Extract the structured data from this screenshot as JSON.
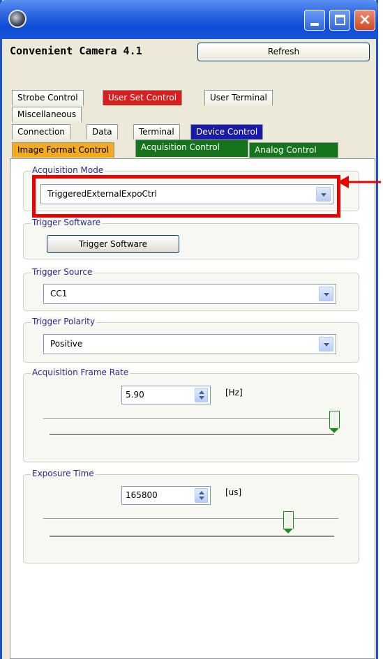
{
  "window": {
    "app_title": "Convenient Camera 4.1",
    "refresh_label": "Refresh"
  },
  "tabs": {
    "row1": [
      {
        "label": "Strobe Control",
        "color": "#ffffff"
      },
      {
        "label": "User Set Control",
        "color": "#d81f1f"
      },
      {
        "label": "User Terminal",
        "color": "#ffffff"
      }
    ],
    "row2": [
      {
        "label": "Miscellaneous",
        "color": "#ffffff"
      }
    ],
    "row3": [
      {
        "label": "Connection",
        "color": "#ffffff"
      },
      {
        "label": "Data",
        "color": "#ffffff"
      },
      {
        "label": "Terminal",
        "color": "#ffffff"
      },
      {
        "label": "Device Control",
        "color": "#1a1aa8"
      }
    ],
    "row4": [
      {
        "label": "Image Format Control",
        "color": "#f5ab1f"
      },
      {
        "label": "Acquisition Control",
        "color": "#16751c",
        "active": true
      },
      {
        "label": "Analog Control",
        "color": "#16751c"
      }
    ]
  },
  "acquisition_mode": {
    "label": "Acquisition Mode",
    "value": "TriggeredExternalExpoCtrl"
  },
  "trigger_software": {
    "label": "Trigger Software",
    "button_label": "Trigger Software"
  },
  "trigger_source": {
    "label": "Trigger Source",
    "value": "CC1"
  },
  "trigger_polarity": {
    "label": "Trigger Polarity",
    "value": "Positive"
  },
  "frame_rate": {
    "label": "Acquisition Frame Rate",
    "value": "5.90",
    "unit": "[Hz]",
    "slider_fraction": 1.0
  },
  "exposure": {
    "label": "Exposure Time",
    "value": "165800",
    "unit": "[us]",
    "slider_fraction": 0.83
  },
  "annotation": {
    "highlight_color": "#ee0000"
  }
}
